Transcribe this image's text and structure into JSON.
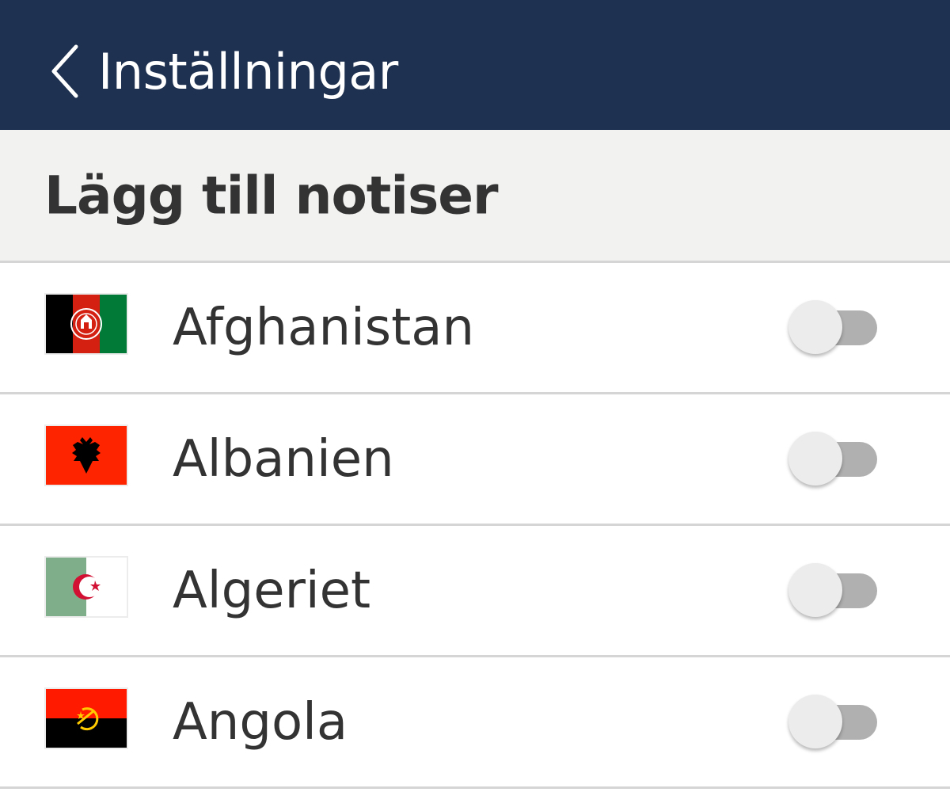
{
  "header": {
    "back_icon": "chevron-left-icon",
    "title": "Inställningar",
    "background": "#1e3150"
  },
  "section": {
    "title": "Lägg till notiser"
  },
  "countries": [
    {
      "name": "Afghanistan",
      "flag_icon": "afghanistan-flag-icon",
      "notifications_on": false
    },
    {
      "name": "Albanien",
      "flag_icon": "albania-flag-icon",
      "notifications_on": false
    },
    {
      "name": "Algeriet",
      "flag_icon": "algeria-flag-icon",
      "notifications_on": false
    },
    {
      "name": "Angola",
      "flag_icon": "angola-flag-icon",
      "notifications_on": false
    }
  ],
  "colors": {
    "toggle_off_track": "#b0b0b0",
    "toggle_off_thumb": "#ececec",
    "divider": "#d5d5d5"
  }
}
